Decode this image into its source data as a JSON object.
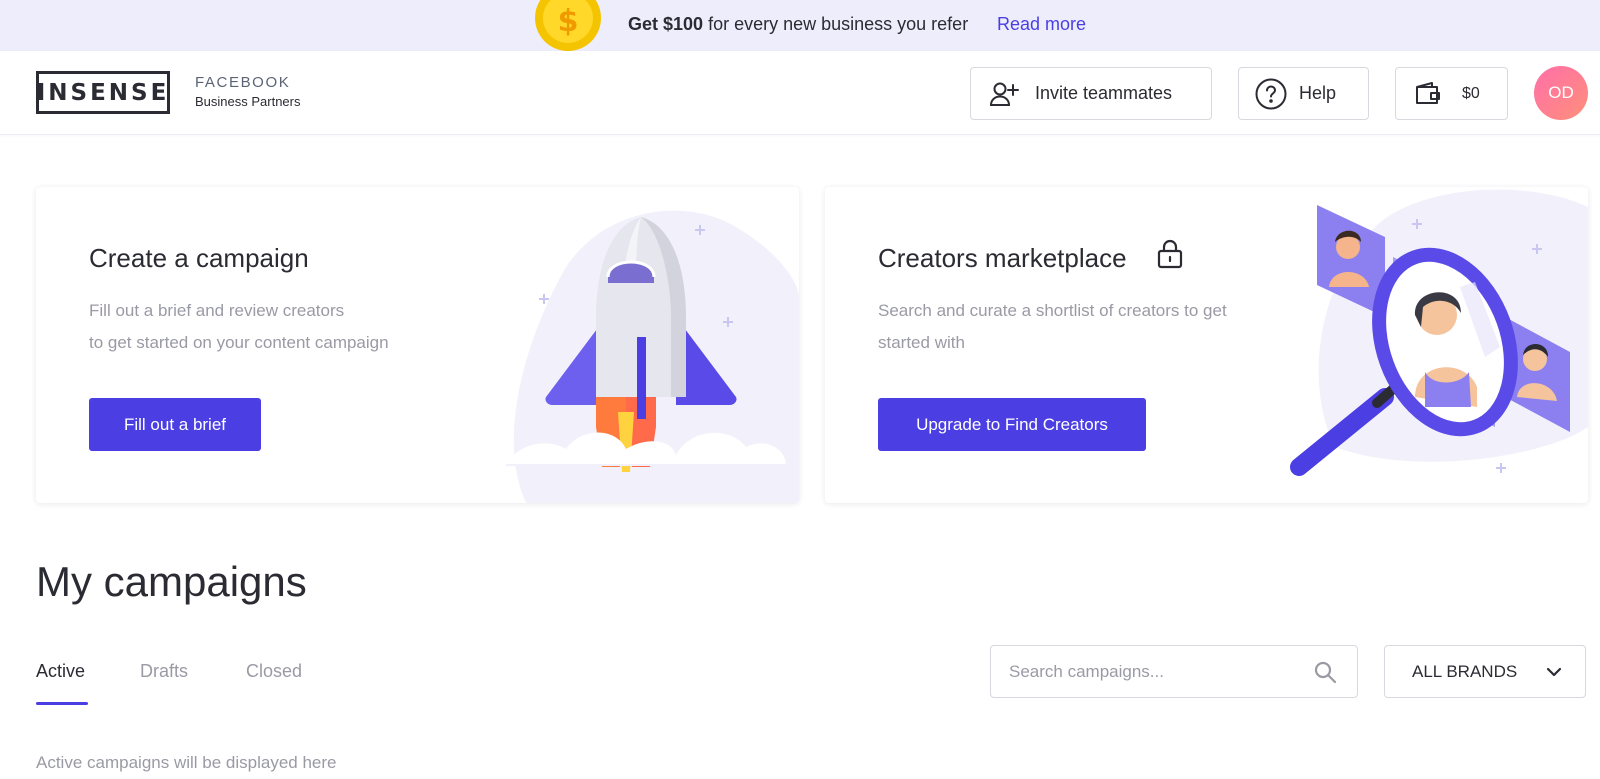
{
  "promo": {
    "bold": "Get $100",
    "text": " for every new business you refer",
    "link": "Read more",
    "coin_symbol": "$"
  },
  "header": {
    "logo": "INSENSE",
    "partner_line1": "FACEBOOK",
    "partner_line2": "Business Partners",
    "invite_label": "Invite teammates",
    "help_label": "Help",
    "wallet_label": "$0",
    "avatar_initials": "OD"
  },
  "cards": {
    "campaign": {
      "title": "Create a campaign",
      "desc_line1": "Fill out a brief and review creators",
      "desc_line2": "to get started on your content campaign",
      "cta": "Fill out a brief"
    },
    "marketplace": {
      "title": "Creators marketplace",
      "desc_line1": "Search and curate a shortlist of creators to get",
      "desc_line2": "started with",
      "cta": "Upgrade to Find Creators"
    }
  },
  "campaigns": {
    "title": "My campaigns",
    "tabs": [
      {
        "label": "Active",
        "active": true
      },
      {
        "label": "Drafts",
        "active": false
      },
      {
        "label": "Closed",
        "active": false
      }
    ],
    "search_placeholder": "Search campaigns...",
    "brand_filter": "ALL BRANDS",
    "empty_text": "Active campaigns will be displayed here"
  },
  "colors": {
    "accent": "#4b3ee3",
    "banner_bg": "#eeedfb",
    "muted_text": "#9a9aa5",
    "avatar_gradient_start": "#ff6fa9",
    "avatar_gradient_end": "#ff8f7a"
  },
  "icons": {
    "coin": "dollar-coin-icon",
    "invite": "user-plus-icon",
    "help": "question-circle-icon",
    "wallet": "wallet-icon",
    "lock": "lock-icon",
    "search": "search-icon",
    "dropdown": "chevron-down-icon"
  }
}
